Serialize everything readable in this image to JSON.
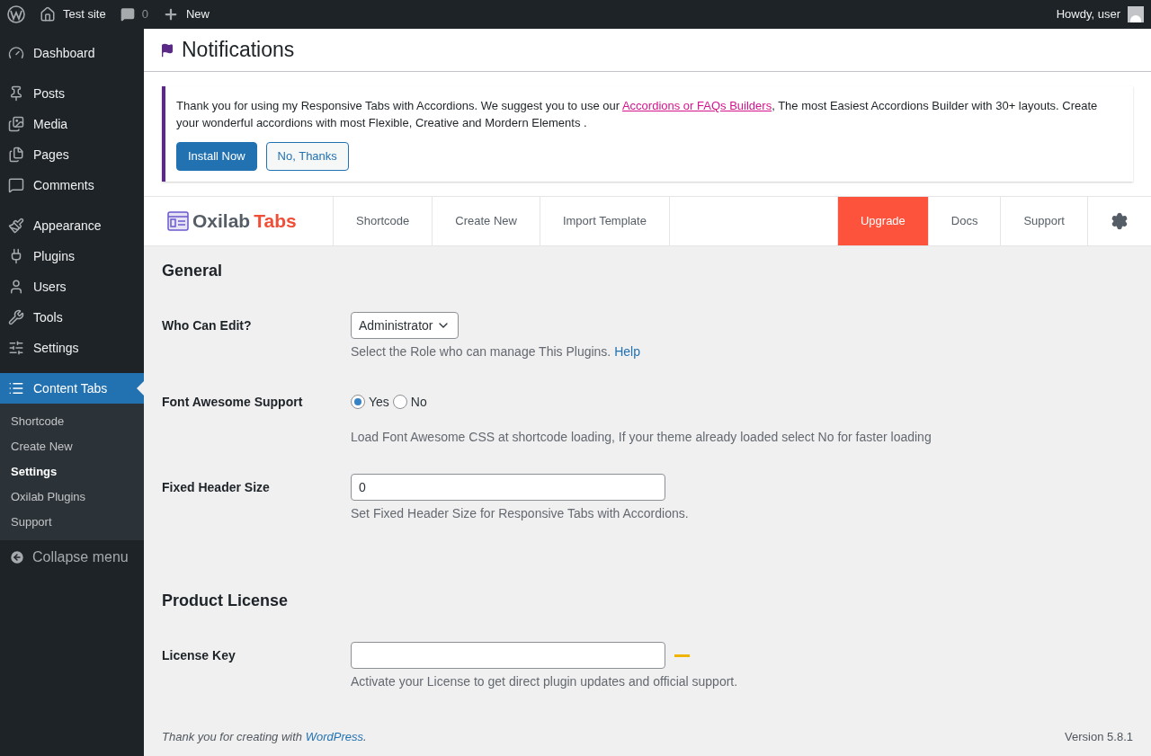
{
  "admin_bar": {
    "site": "Test site",
    "comments": "0",
    "new": "New",
    "greeting": "Howdy, user"
  },
  "sidebar": {
    "groups": [
      [
        {
          "label": "Dashboard",
          "selected": false
        }
      ],
      [
        {
          "label": "Posts",
          "selected": false
        },
        {
          "label": "Media",
          "selected": false
        },
        {
          "label": "Pages",
          "selected": false
        },
        {
          "label": "Comments",
          "selected": false
        }
      ],
      [
        {
          "label": "Appearance",
          "selected": false
        },
        {
          "label": "Plugins",
          "selected": false
        },
        {
          "label": "Users",
          "selected": false
        },
        {
          "label": "Tools",
          "selected": false
        },
        {
          "label": "Settings",
          "selected": false
        }
      ],
      [
        {
          "label": "Content Tabs",
          "selected": true,
          "children": [
            {
              "label": "Shortcode",
              "selected": false
            },
            {
              "label": "Create New",
              "selected": false
            },
            {
              "label": "Settings",
              "selected": true
            },
            {
              "label": "Oxilab Plugins",
              "selected": false
            },
            {
              "label": "Support",
              "selected": false
            }
          ]
        }
      ]
    ],
    "collapse": "Collapse menu"
  },
  "page_title": "Notifications",
  "notice": {
    "before": "Thank you for using my Responsive Tabs with Accordions. We suggest you to use our ",
    "link": "Accordions or FAQs Builders",
    "after": ", The most Easiest Accordions Builder with 30+ layouts. Create your wonderful accordions with most Flexible, Creative and Mordern Elements .",
    "buttons": [
      {
        "label": "Install Now",
        "kind": "primary"
      },
      {
        "label": "No, Thanks",
        "kind": "secondary"
      }
    ]
  },
  "plugin_nav": {
    "logo": {
      "name": "Oxilab",
      "accent": "Tabs"
    },
    "left_items": [
      {
        "label": "Shortcode",
        "highlighted": false
      },
      {
        "label": "Create New",
        "highlighted": false
      },
      {
        "label": "Import Template",
        "highlighted": false
      }
    ],
    "right_items": [
      {
        "label": "Upgrade",
        "highlighted": true
      },
      {
        "label": "Docs",
        "highlighted": false
      },
      {
        "label": "Support",
        "highlighted": false
      }
    ]
  },
  "sections": [
    {
      "title": "General",
      "fields": [
        {
          "kind": "select",
          "label": "Who Can Edit?",
          "value": "Administrator",
          "help": "Select the Role who can manage This Plugins.",
          "link": "Help"
        },
        {
          "kind": "radio",
          "label": "Font Awesome Support",
          "options": [
            {
              "label": "Yes",
              "selected": true
            },
            {
              "label": "No",
              "selected": false
            }
          ],
          "help": "Load Font Awesome CSS at shortcode loading, If your theme already loaded select No for faster loading"
        },
        {
          "kind": "text",
          "label": "Fixed Header Size",
          "value": "0",
          "help": "Set Fixed Header Size for Responsive Tabs with Accordions."
        }
      ]
    },
    {
      "title": "Product License",
      "fields": [
        {
          "kind": "license",
          "label": "License Key",
          "help": "Activate your License to get direct plugin updates and official support."
        }
      ]
    }
  ],
  "footer": {
    "text": "Thank you for creating with ",
    "link": "WordPress",
    "end": ".",
    "version": "Version 5.8.1"
  }
}
